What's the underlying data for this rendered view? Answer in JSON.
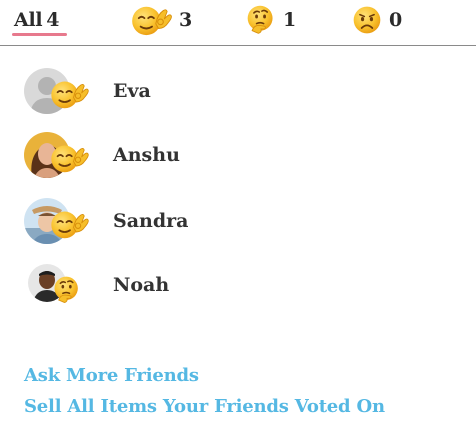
{
  "tabs": [
    {
      "id": "all",
      "label": "All",
      "count": "4"
    },
    {
      "id": "ok-hand",
      "icon": "ok-hand-emoji-icon",
      "count": "3"
    },
    {
      "id": "thinking",
      "icon": "thinking-emoji-icon",
      "count": "1"
    },
    {
      "id": "sad",
      "icon": "sad-emoji-icon",
      "count": "0"
    }
  ],
  "active_tab": "all",
  "friends": [
    {
      "name": "Eva",
      "avatar": "default-avatar-icon",
      "reaction": "ok-hand-emoji-icon"
    },
    {
      "name": "Anshu",
      "avatar": "photo",
      "reaction": "ok-hand-emoji-icon"
    },
    {
      "name": "Sandra",
      "avatar": "photo",
      "reaction": "ok-hand-emoji-icon"
    },
    {
      "name": "Noah",
      "avatar": "photo",
      "reaction": "thinking-emoji-icon"
    }
  ],
  "actions": {
    "ask_more": "Ask More Friends",
    "sell_all": "Sell All Items Your Friends Voted On"
  },
  "colors": {
    "accent_underline": "#e7798d",
    "link": "#55b8e3",
    "emoji_yellow": "#f5b81c"
  }
}
